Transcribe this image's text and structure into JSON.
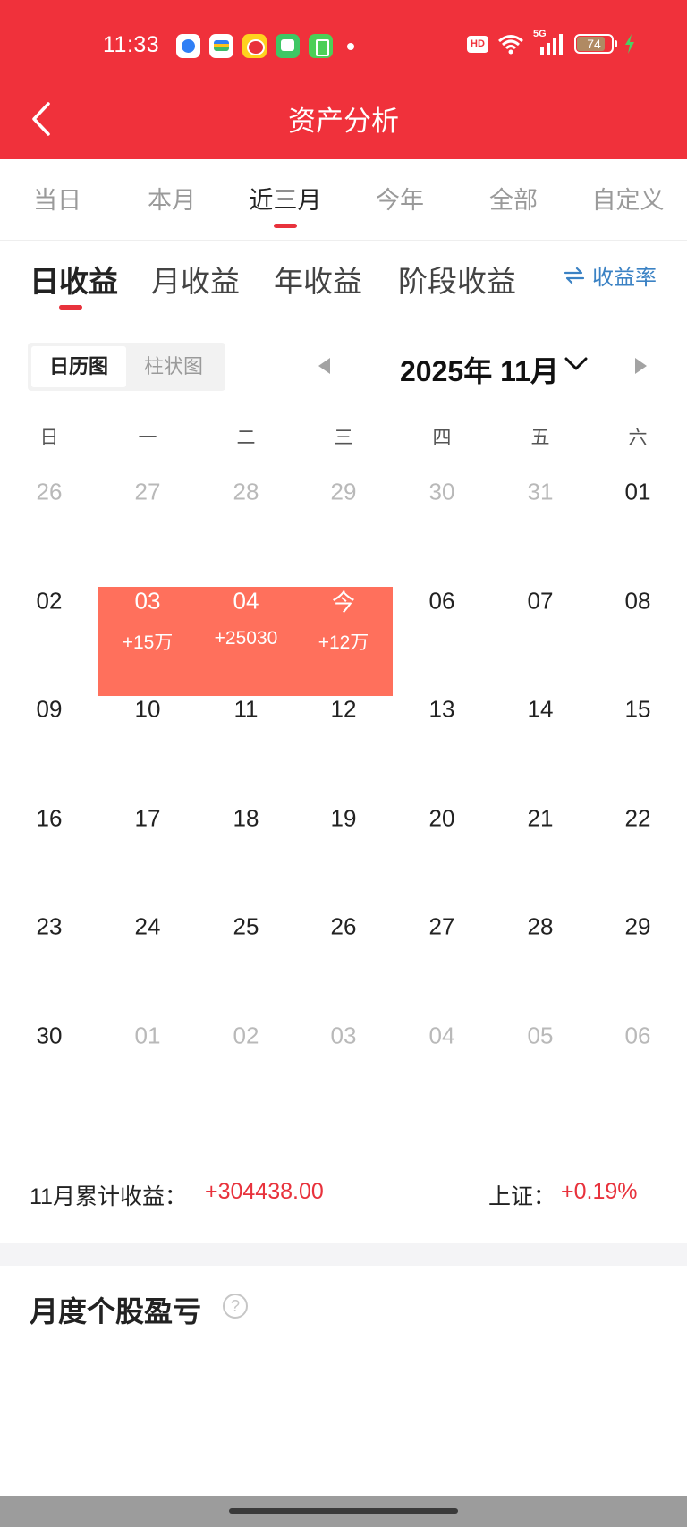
{
  "status_bar": {
    "time": "11:33",
    "hd": "HD",
    "network": "5G",
    "battery": "74"
  },
  "header": {
    "title": "资产分析"
  },
  "period_tabs": [
    {
      "label": "当日",
      "active": false
    },
    {
      "label": "本月",
      "active": false
    },
    {
      "label": "近三月",
      "active": true
    },
    {
      "label": "今年",
      "active": false
    },
    {
      "label": "全部",
      "active": false
    },
    {
      "label": "自定义",
      "active": false
    }
  ],
  "earning_tabs": [
    {
      "label": "日收益",
      "active": true
    },
    {
      "label": "月收益",
      "active": false
    },
    {
      "label": "年收益",
      "active": false
    },
    {
      "label": "阶段收益",
      "active": false
    }
  ],
  "rate_toggle": {
    "icon": "swap-icon",
    "label": "收益率"
  },
  "view_toggle": [
    {
      "label": "日历图",
      "active": true
    },
    {
      "label": "柱状图",
      "active": false
    }
  ],
  "month_picker": {
    "label": "2025年 11月"
  },
  "weekdays": [
    "日",
    "一",
    "二",
    "三",
    "四",
    "五",
    "六"
  ],
  "calendar": {
    "rows": [
      [
        {
          "day": "26",
          "muted": true
        },
        {
          "day": "27",
          "muted": true
        },
        {
          "day": "28",
          "muted": true
        },
        {
          "day": "29",
          "muted": true
        },
        {
          "day": "30",
          "muted": true
        },
        {
          "day": "31",
          "muted": true
        },
        {
          "day": "01"
        }
      ],
      [
        {
          "day": "02"
        },
        {
          "day": "03",
          "amount": "+15万",
          "hl": true
        },
        {
          "day": "04",
          "amount": "+25030",
          "hl": true
        },
        {
          "day": "今",
          "amount": "+12万",
          "hl": true
        },
        {
          "day": "06"
        },
        {
          "day": "07"
        },
        {
          "day": "08"
        }
      ],
      [
        {
          "day": "09"
        },
        {
          "day": "10"
        },
        {
          "day": "11"
        },
        {
          "day": "12"
        },
        {
          "day": "13"
        },
        {
          "day": "14"
        },
        {
          "day": "15"
        }
      ],
      [
        {
          "day": "16"
        },
        {
          "day": "17"
        },
        {
          "day": "18"
        },
        {
          "day": "19"
        },
        {
          "day": "20"
        },
        {
          "day": "21"
        },
        {
          "day": "22"
        }
      ],
      [
        {
          "day": "23"
        },
        {
          "day": "24"
        },
        {
          "day": "25"
        },
        {
          "day": "26"
        },
        {
          "day": "27"
        },
        {
          "day": "28"
        },
        {
          "day": "29"
        }
      ],
      [
        {
          "day": "30"
        },
        {
          "day": "01",
          "muted": true
        },
        {
          "day": "02",
          "muted": true
        },
        {
          "day": "03",
          "muted": true
        },
        {
          "day": "04",
          "muted": true
        },
        {
          "day": "05",
          "muted": true
        },
        {
          "day": "06",
          "muted": true
        }
      ]
    ],
    "highlight_color": "#ff705c"
  },
  "summary": {
    "label": "11月累计收益：",
    "value": "+304438.00",
    "index_label": "上证：",
    "index_value": "+0.19%"
  },
  "section": {
    "title": "月度个股盈亏",
    "help": "?"
  },
  "colors": {
    "brand_red": "#f0313b",
    "gain_red": "#e8323c",
    "link_blue": "#3b82c4"
  }
}
